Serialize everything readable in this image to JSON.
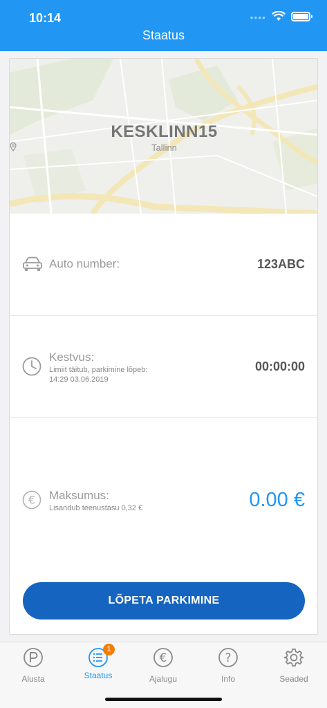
{
  "status_bar": {
    "time": "10:14"
  },
  "header": {
    "title": "Staatus"
  },
  "zone": {
    "name": "KESKLINN15",
    "city": "Tallinn"
  },
  "car": {
    "label": "Auto number:",
    "value": "123ABC"
  },
  "duration": {
    "label": "Kestvus:",
    "note": "Limiit täitub, parkimine lõpeb:",
    "end_time": "14:29 03.06.2019",
    "value": "00:00:00"
  },
  "payment": {
    "label": "Maksumus:",
    "note": "Lisandub teenustasu 0,32 €",
    "value": "0.00 €"
  },
  "action": {
    "end_label": "LÕPETA PARKIMINE"
  },
  "tabs": [
    {
      "label": "Alusta",
      "icon": "parking-icon",
      "active": false
    },
    {
      "label": "Staatus",
      "icon": "list-icon",
      "active": true,
      "badge": "1"
    },
    {
      "label": "Ajalugu",
      "icon": "euro-icon",
      "active": false
    },
    {
      "label": "Info",
      "icon": "question-icon",
      "active": false
    },
    {
      "label": "Seaded",
      "icon": "gear-icon",
      "active": false
    }
  ],
  "colors": {
    "primary": "#2196f3",
    "button": "#1565c0",
    "badge": "#f57c00"
  }
}
